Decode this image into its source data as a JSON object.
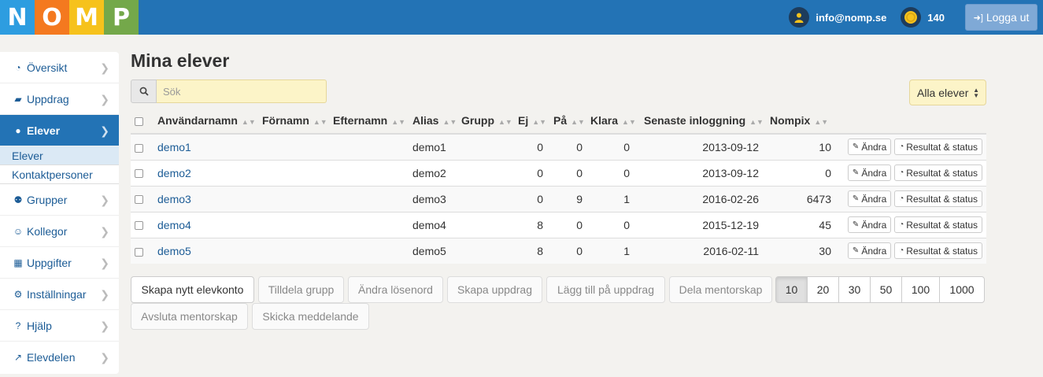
{
  "header": {
    "logo": [
      "N",
      "O",
      "M",
      "P"
    ],
    "logo_colors": [
      "#2d9de0",
      "#f4791f",
      "#f6c21c",
      "#74a84a"
    ],
    "user_email": "info@nomp.se",
    "coins": "140",
    "logout_label": "Logga ut"
  },
  "sidebar": {
    "items": [
      {
        "label": "Översikt",
        "icon": "dashboard-icon"
      },
      {
        "label": "Uppdrag",
        "icon": "book-icon"
      },
      {
        "label": "Elever",
        "icon": "user-icon"
      },
      {
        "label": "Grupper",
        "icon": "users-icon"
      },
      {
        "label": "Kollegor",
        "icon": "smile-icon"
      },
      {
        "label": "Uppgifter",
        "icon": "grid-icon"
      },
      {
        "label": "Inställningar",
        "icon": "gear-icon"
      },
      {
        "label": "Hjälp",
        "icon": "question-icon"
      },
      {
        "label": "Elevdelen",
        "icon": "external-link-icon"
      }
    ],
    "sub_items": [
      "Elever",
      "Kontaktpersoner"
    ]
  },
  "main": {
    "title": "Mina elever",
    "search_placeholder": "Sök",
    "filter_label": "Alla elever"
  },
  "table": {
    "headers": [
      "Användarnamn",
      "Förnamn",
      "Efternamn",
      "Alias",
      "Grupp",
      "Ej",
      "På",
      "Klara",
      "Senaste inloggning",
      "Nompix"
    ],
    "edit_label": "Ändra",
    "results_label": "Resultat & status",
    "rows": [
      {
        "username": "demo1",
        "first": "",
        "last": "",
        "alias": "demo1",
        "group": "",
        "ej": "0",
        "pa": "0",
        "klara": "0",
        "login": "2013-09-12",
        "nompix": "10"
      },
      {
        "username": "demo2",
        "first": "",
        "last": "",
        "alias": "demo2",
        "group": "",
        "ej": "0",
        "pa": "0",
        "klara": "0",
        "login": "2013-09-12",
        "nompix": "0"
      },
      {
        "username": "demo3",
        "first": "",
        "last": "",
        "alias": "demo3",
        "group": "",
        "ej": "0",
        "pa": "9",
        "klara": "1",
        "login": "2016-02-26",
        "nompix": "6473"
      },
      {
        "username": "demo4",
        "first": "",
        "last": "",
        "alias": "demo4",
        "group": "",
        "ej": "8",
        "pa": "0",
        "klara": "0",
        "login": "2015-12-19",
        "nompix": "45"
      },
      {
        "username": "demo5",
        "first": "",
        "last": "",
        "alias": "demo5",
        "group": "",
        "ej": "8",
        "pa": "0",
        "klara": "1",
        "login": "2016-02-11",
        "nompix": "30"
      }
    ]
  },
  "actions": {
    "create_account": "Skapa nytt elevkonto",
    "assign_group": "Tilldela grupp",
    "change_password": "Ändra lösenord",
    "create_assignment": "Skapa uppdrag",
    "add_to_assignment": "Lägg till på uppdrag",
    "share_mentorship": "Dela mentorskap",
    "end_mentorship": "Avsluta mentorskap",
    "send_message": "Skicka meddelande"
  },
  "pagination": {
    "sizes": [
      "10",
      "20",
      "30",
      "50",
      "100",
      "1000"
    ],
    "active": "10"
  }
}
